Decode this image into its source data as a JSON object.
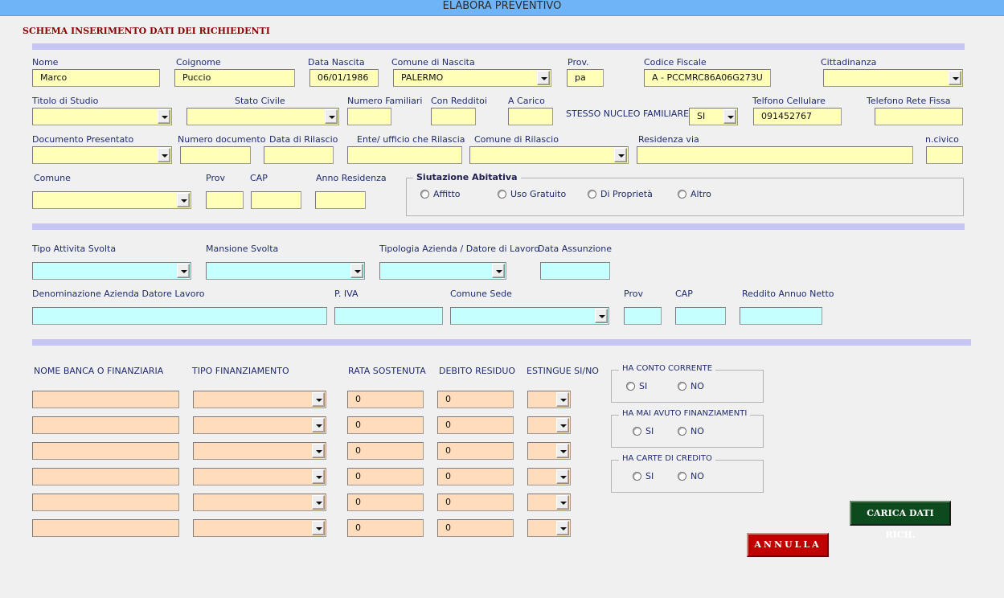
{
  "window": {
    "title": "ELABORA   PREVENTIVO"
  },
  "section_title": "SCHEMA INSERIMENTO DATI DEI RICHIEDENTI",
  "labels": {
    "nome": "Nome",
    "cognome": "Coignome",
    "data_nascita": "Data Nascita",
    "comune_nascita": "Comune di Nascita",
    "prov": "Prov.",
    "codice_fiscale": "Codice Fiscale",
    "cittadinanza": "Cittadinanza",
    "titolo_studio": "Titolo di Studio",
    "stato_civile": "Stato Civile",
    "numero_familiari": "Numero Familiari",
    "con_redditi": "Con Redditoi",
    "a_carico": "A Carico",
    "stesso_nucleo": "STESSO NUCLEO FAMILIARE",
    "telefono_cellulare": "Telfono Cellulare",
    "telefono_fisso": "Telefono Rete Fissa",
    "documento": "Documento Presentato",
    "numero_documento": "Numero documento",
    "data_rilascio": "Data di Rilascio",
    "ente_rilascio": "Ente/ ufficio che Rilascia",
    "comune_rilascio": "Comune di Rilascio",
    "residenza_via": "Residenza via",
    "n_civico": "n.civico",
    "comune": "Comune",
    "prov2": "Prov",
    "cap": "CAP",
    "anno_residenza": "Anno Residenza",
    "tipo_attivita": "Tipo Attivita Svolta",
    "mansione": "Mansione Svolta",
    "tipologia_azienda": "Tipologia Azienda / Datore di Lavoro",
    "data_assunzione": "Data Assunzione",
    "denominazione_azienda": "Denominazione Azienda Datore Lavoro",
    "piva": "P. IVA",
    "comune_sede": "Comune Sede",
    "prov3": "Prov",
    "cap2": "CAP",
    "reddito": "Reddito Annuo Netto",
    "nome_banca": "NOME BANCA O FINANZIARIA",
    "tipo_finanziamento": "TIPO FINANZIAMENTO",
    "rata": "RATA SOSTENUTA",
    "debito": "DEBITO RESIDUO",
    "estingue": "ESTINGUE  SI/NO"
  },
  "values": {
    "nome": "Marco",
    "cognome": "Puccio",
    "data_nascita": "06/01/1986",
    "comune_nascita": "PALERMO",
    "prov": "pa",
    "codice_fiscale": "A - PCCMRC86A06G273U",
    "stesso_nucleo": "SI",
    "telefono_cellulare": "091452767"
  },
  "abitativa": {
    "title": "Siutazione Abitativa",
    "options": [
      "Affitto",
      "Uso Gratuito",
      "Di Proprietà",
      "Altro"
    ]
  },
  "finanziamenti_rows": [
    {
      "rata": "0",
      "debito": "0"
    },
    {
      "rata": "0",
      "debito": "0"
    },
    {
      "rata": "0",
      "debito": "0"
    },
    {
      "rata": "0",
      "debito": "0"
    },
    {
      "rata": "0",
      "debito": "0"
    },
    {
      "rata": "0",
      "debito": "0"
    }
  ],
  "frames": {
    "conto_corrente": {
      "title": "HA CONTO CORRENTE",
      "si": "SI",
      "no": "NO"
    },
    "finanziamenti": {
      "title": "HA MAI AVUTO FINANZIAMENTI",
      "si": "SI",
      "no": "NO"
    },
    "carte": {
      "title": "HA CARTE DI CREDITO",
      "si": "SI",
      "no": "NO"
    }
  },
  "buttons": {
    "carica": "CARICA DATI RICH.",
    "annulla": "ANNULLA"
  },
  "colors": {
    "titlebar": "#6fb4f7",
    "field_yellow": "#ffffb8",
    "field_cyan": "#c5fffe",
    "field_peach": "#ffdcbc",
    "separator": "#c6c6f5",
    "btn_green": "#0d4a1d",
    "btn_red": "#c00000",
    "section_title": "#8b0000"
  }
}
